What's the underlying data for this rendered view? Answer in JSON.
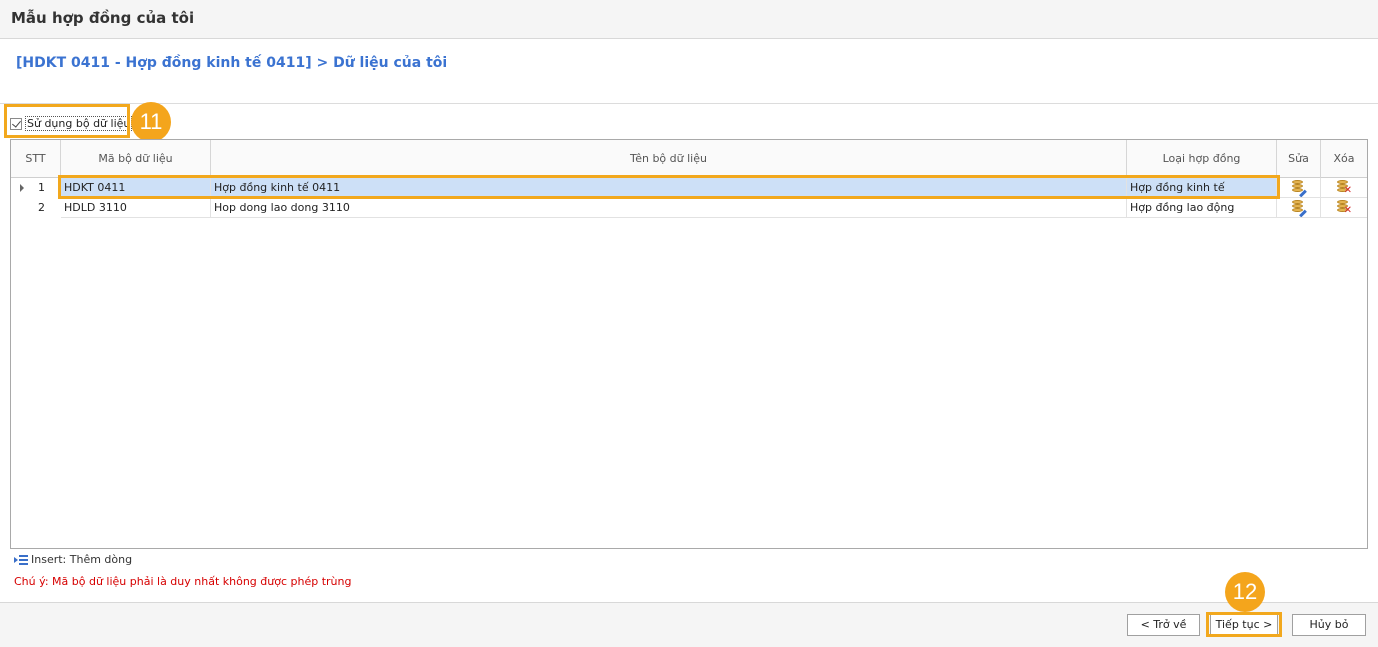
{
  "window": {
    "title": "Mẫu hợp đồng của tôi"
  },
  "breadcrumb": "[HDKT 0411 - Hợp đồng kinh tế 0411] > Dữ liệu của tôi",
  "use_dataset": {
    "label": "Sử dụng bộ dữ liệu",
    "checked": true
  },
  "grid": {
    "columns": [
      "STT",
      "Mã bộ dữ liệu",
      "Tên bộ dữ liệu",
      "Loại hợp đồng",
      "Sửa",
      "Xóa"
    ],
    "rows": [
      {
        "stt": "1",
        "code": "HDKT 0411",
        "name": "Hợp đồng kinh tế 0411",
        "type": "Hợp đồng kinh tế",
        "selected": true
      },
      {
        "stt": "2",
        "code": "HDLD 3110",
        "name": "Hop dong lao dong 3110",
        "type": "Hợp đồng lao động",
        "selected": false
      }
    ],
    "icons": {
      "edit": "database-edit-icon",
      "delete": "database-delete-icon"
    }
  },
  "hint": "Insert: Thêm dòng",
  "note": "Chú ý: Mã bộ dữ liệu phải là duy nhất không được phép trùng",
  "buttons": {
    "back": "< Trở về",
    "next": "Tiếp tục >",
    "cancel": "Hủy bỏ"
  },
  "callouts": {
    "first": "11",
    "second": "12"
  },
  "colors": {
    "accent": "#f4a51c",
    "link": "#3b73d1",
    "selected_row": "#cde0f7",
    "note": "#d60000"
  }
}
